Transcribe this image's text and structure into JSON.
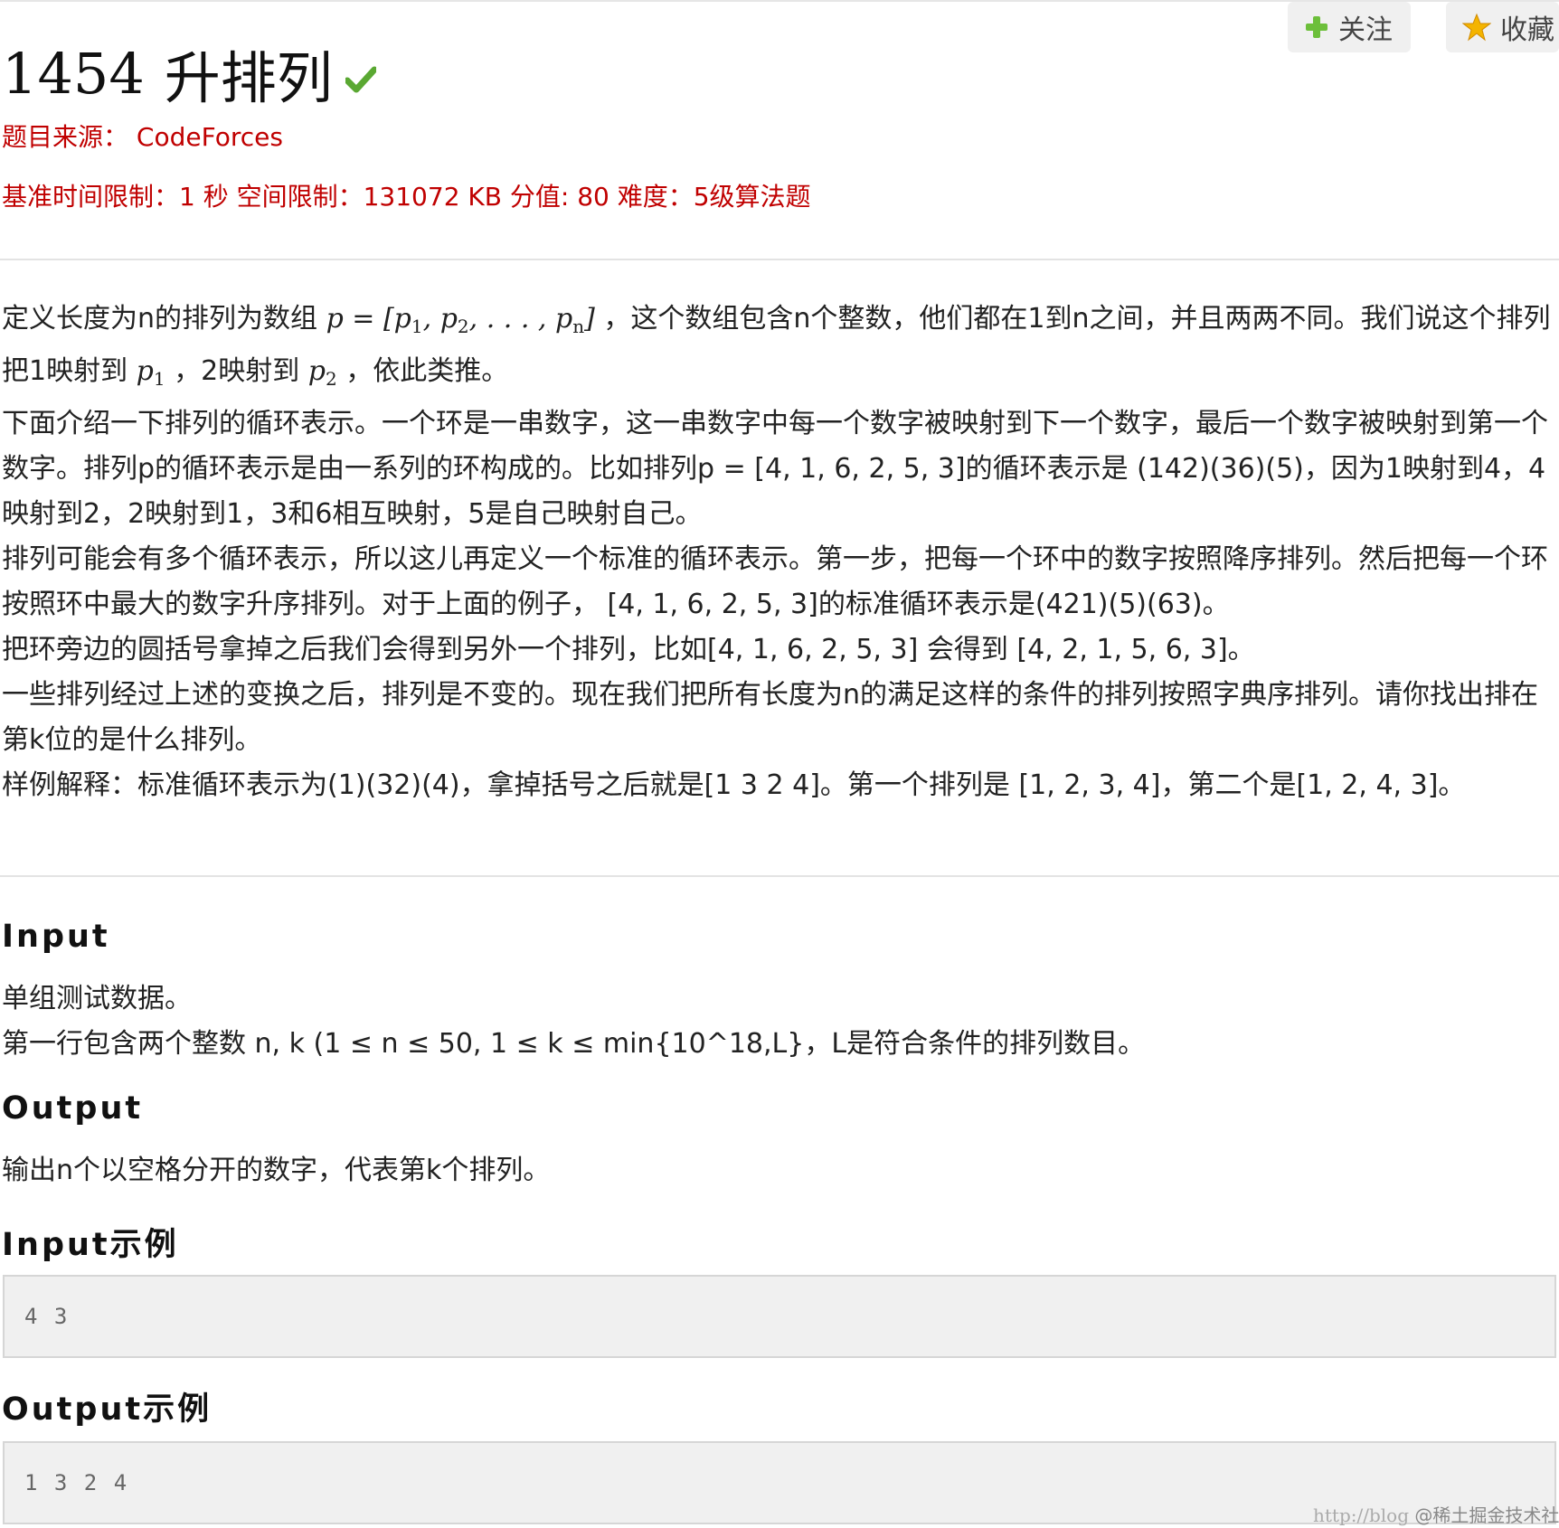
{
  "header": {
    "problem_number": "1454",
    "problem_title": "升排列",
    "follow_label": "关注",
    "favorite_label": "收藏"
  },
  "meta": {
    "source_label": "题目来源：",
    "source_value": "CodeForces",
    "limits": "基准时间限制：1 秒 空间限制：131072 KB 分值: 80 难度：5级算法题"
  },
  "description": {
    "p1_a": "定义长度为n的排列为数组 ",
    "p1_math": "p = [p1, p2, . . . , pn]",
    "p1_b": " ，这个数组包含n个整数，他们都在1到n之间，并且两两不同。我们说这个排列把1映射到 ",
    "p1_c": " ，2映射到 ",
    "p1_d": " ，依此类推。",
    "p2": "下面介绍一下排列的循环表示。一个环是一串数字，这一串数字中每一个数字被映射到下一个数字，最后一个数字被映射到第一个数字。排列p的循环表示是由一系列的环构成的。比如排列p = [4, 1, 6, 2, 5, 3]的循环表示是 (142)(36)(5)，因为1映射到4，4映射到2，2映射到1，3和6相互映射，5是自己映射自己。",
    "p3": "排列可能会有多个循环表示，所以这儿再定义一个标准的循环表示。第一步，把每一个环中的数字按照降序排列。然后把每一个环按照环中最大的数字升序排列。对于上面的例子， [4, 1, 6, 2, 5, 3]的标准循环表示是(421)(5)(63)。",
    "p4": "把环旁边的圆括号拿掉之后我们会得到另外一个排列，比如[4, 1, 6, 2, 5, 3] 会得到 [4, 2, 1, 5, 6, 3]。",
    "p5": "一些排列经过上述的变换之后，排列是不变的。现在我们把所有长度为n的满足这样的条件的排列按照字典序排列。请你找出排在第k位的是什么排列。",
    "p6": "样例解释：标准循环表示为(1)(32)(4)，拿掉括号之后就是[1 3 2 4]。第一个排列是 [1, 2, 3, 4]，第二个是[1, 2, 4, 3]。"
  },
  "input_section": {
    "heading": "Input",
    "line1": "单组测试数据。",
    "line2": "第一行包含两个整数 n, k (1 ≤ n ≤ 50, 1 ≤ k ≤ min{10^18,L}，L是符合条件的排列数目。"
  },
  "output_section": {
    "heading": "Output",
    "line1": "输出n个以空格分开的数字，代表第k个排列。"
  },
  "input_example": {
    "heading": "Input示例",
    "value": "4 3"
  },
  "output_example": {
    "heading": "Output示例",
    "value": "1 3 2 4"
  },
  "watermark": {
    "url": "http://blog",
    "brand": "@稀土掘金技术社区"
  },
  "colors": {
    "accent_red": "#c00000",
    "check_green": "#5aa832",
    "sample_bg": "#f0f0f0"
  }
}
